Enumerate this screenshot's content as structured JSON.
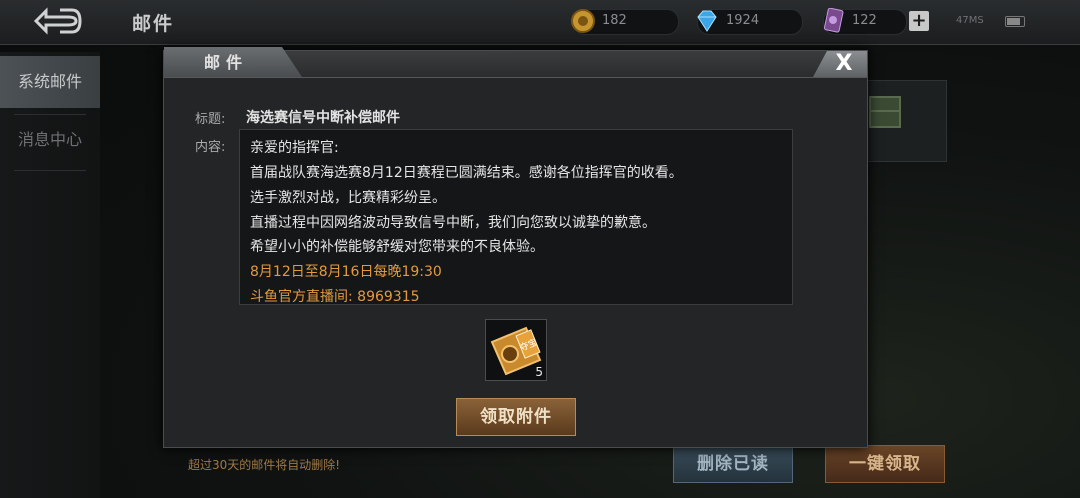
{
  "header": {
    "title": "邮件",
    "gold": "182",
    "diamond": "1924",
    "tickets": "122",
    "plus": "+",
    "net": "47MS"
  },
  "sidebar": {
    "items": [
      {
        "label": "系统邮件",
        "active": true
      },
      {
        "label": "消息中心",
        "active": false
      }
    ]
  },
  "modal": {
    "tab_title": "邮件",
    "close": "X",
    "subject_label": "标题:",
    "subject": "海选赛信号中断补偿邮件",
    "content_label": "内容:",
    "content_lines": [
      "亲爱的指挥官:",
      "首届战队赛海选赛8月12日赛程已圆满结束。感谢各位指挥官的收看。",
      "选手激烈对战，比赛精彩纷呈。",
      "直播过程中因网络波动导致信号中断，我们向您致以诚挚的歉意。",
      "希望小小的补偿能够舒缓对您带来的不良体验。"
    ],
    "highlight_lines": [
      "8月12日至8月16日每晚19:30",
      "斗鱼官方直播间: 8969315"
    ],
    "attachment": {
      "icon": "treasure-ticket-icon",
      "badge": "夺宝",
      "count": "5"
    },
    "claim_label": "领取附件"
  },
  "footer": {
    "auto_delete_note": "超过30天的邮件将自动删除!",
    "mark_read_label": "删除已读",
    "claim_all_label": "一键领取"
  },
  "colors": {
    "accent_orange": "#e39a3f",
    "claim_button": "#8a6238"
  }
}
